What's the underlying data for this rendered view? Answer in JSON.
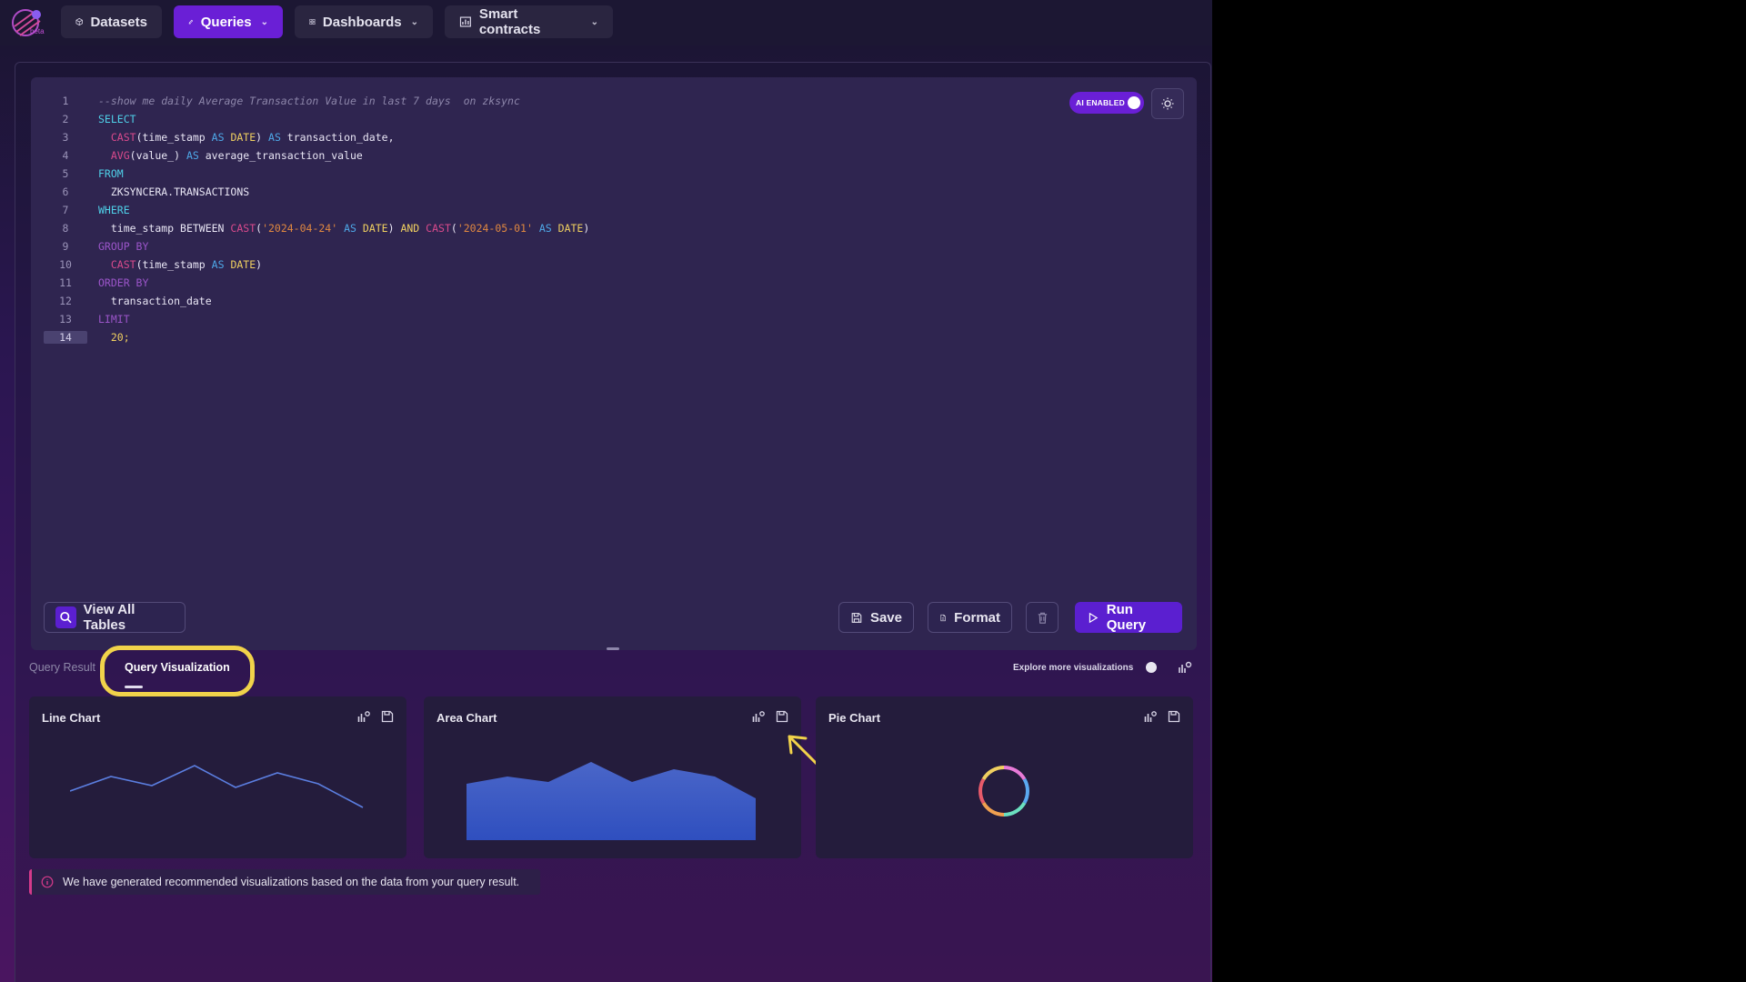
{
  "nav": {
    "logo_badge": "beta",
    "items": [
      {
        "label": "Datasets",
        "icon": "cube-icon"
      },
      {
        "label": "Queries",
        "icon": "edit-icon",
        "active": true
      },
      {
        "label": "Dashboards",
        "icon": "grid-icon"
      },
      {
        "label": "Smart contracts",
        "icon": "bar-chart-icon"
      }
    ]
  },
  "editor": {
    "lines": [
      "1",
      "2",
      "3",
      "4",
      "5",
      "6",
      "7",
      "8",
      "9",
      "10",
      "11",
      "12",
      "13",
      "14"
    ],
    "current_line": "14",
    "code": {
      "l1": "--show me daily Average Transaction Value in last 7 days  on zksync",
      "select": "SELECT",
      "cast": "CAST",
      "avg": "AVG",
      "l3a": "(time_stamp ",
      "as": "AS",
      "date": "DATE",
      "l3b": ") ",
      "l3c": " transaction_date,",
      "l4a": "(value_) ",
      "l4b": " average_transaction_value",
      "from": "FROM",
      "l6": "ZKSYNCERA.TRANSACTIONS",
      "where": "WHERE",
      "l8a": "time_stamp BETWEEN ",
      "str1": "'2024-04-24'",
      "and": "AND",
      "str2": "'2024-05-01'",
      "groupby": "GROUP BY",
      "orderby": "ORDER BY",
      "l12": "transaction_date",
      "limit": "LIMIT",
      "l14": "20;"
    },
    "ai_label": "AI ENABLED",
    "view_all_tables": "View All Tables",
    "save": "Save",
    "format": "Format",
    "run_query": "Run Query"
  },
  "tabs": {
    "results": "Query Result",
    "visualization": "Query Visualization",
    "explore": "Explore more visualizations"
  },
  "cards": [
    {
      "title": "Line Chart"
    },
    {
      "title": "Area Chart"
    },
    {
      "title": "Pie Chart"
    }
  ],
  "notice": "We have generated recommended visualizations based on the data from your query result.",
  "colors": {
    "accent": "#6a1fd6",
    "highlight": "#f1d34a",
    "line_series": "#5b7ee0",
    "area_fill": "#3b5bc6"
  }
}
